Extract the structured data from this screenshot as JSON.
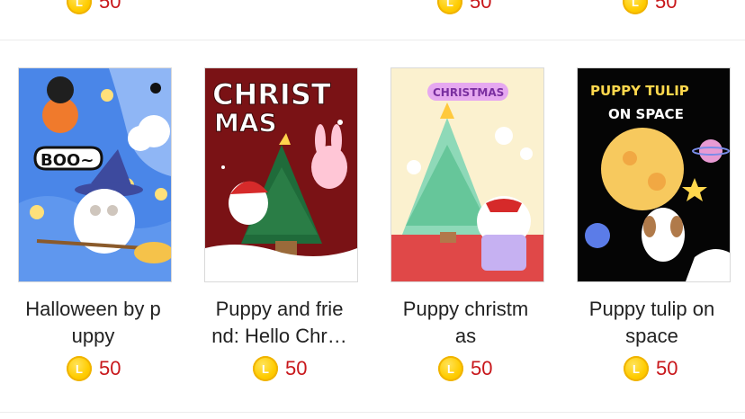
{
  "top_row": {
    "prices": [
      {
        "coin_label": "L",
        "value": "50"
      },
      {
        "coin_label": "L",
        "value": "50"
      },
      {
        "coin_label": "L",
        "value": "50"
      }
    ]
  },
  "stickers": [
    {
      "title_line1": "Halloween by p",
      "title_line2": "uppy",
      "coin_label": "L",
      "price": "50",
      "art_text": "BOO~"
    },
    {
      "title_line1": "Puppy and frie",
      "title_line2": "nd: Hello Chr…",
      "coin_label": "L",
      "price": "50",
      "art_text_1": "CHRIST",
      "art_text_2": "MAS"
    },
    {
      "title_line1": "Puppy christm",
      "title_line2": "as",
      "coin_label": "L",
      "price": "50",
      "art_text": "CHRISTMAS"
    },
    {
      "title_line1": "Puppy tulip on",
      "title_line2": "space",
      "coin_label": "L",
      "price": "50",
      "art_text_1": "PUPPY TULIP",
      "art_text_2": "ON SPACE"
    }
  ],
  "colors": {
    "price": "#c8171b",
    "coin": "#ffcc00",
    "divider": "#ececec"
  }
}
